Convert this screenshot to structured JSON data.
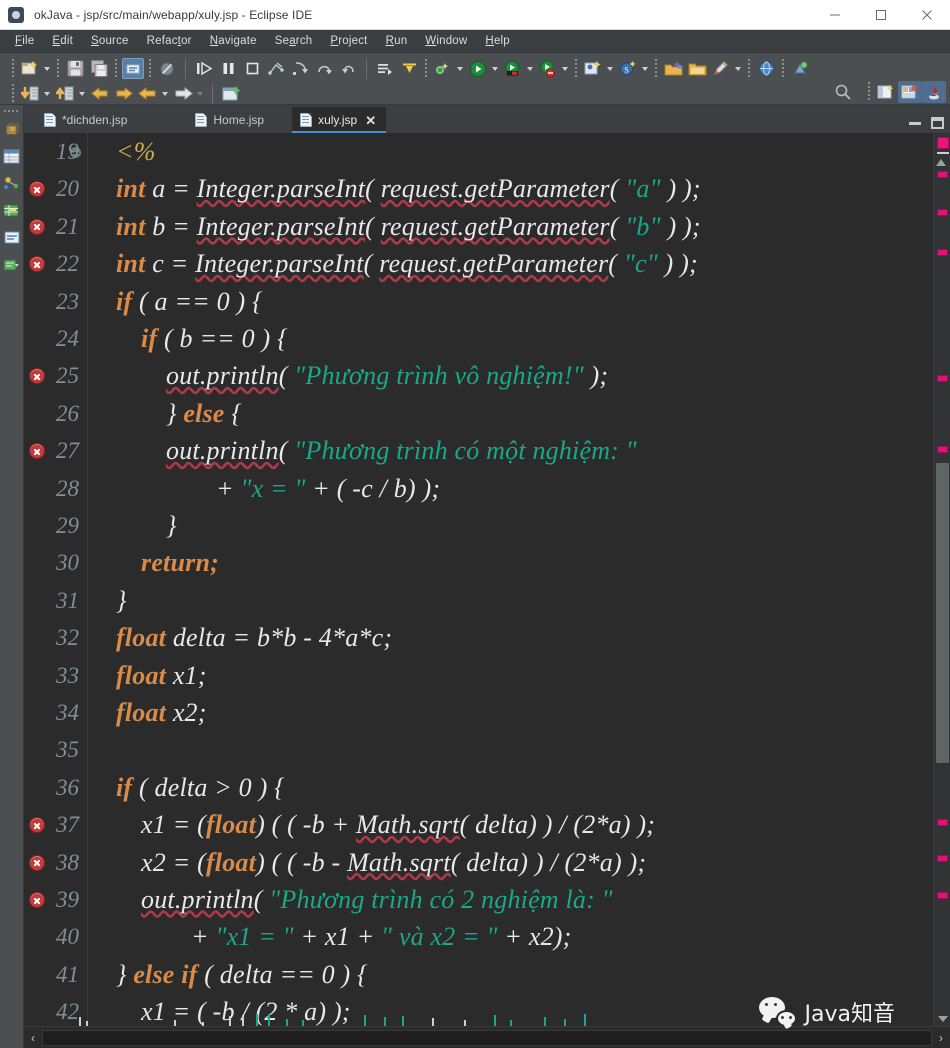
{
  "window": {
    "title": "okJava - jsp/src/main/webapp/xuly.jsp - Eclipse IDE",
    "app_icon": "eclipse-icon",
    "minimize_label": "—",
    "maximize_label": "☐",
    "close_label": "✕"
  },
  "menubar": {
    "items": [
      {
        "label": "File",
        "mnemonic": "F"
      },
      {
        "label": "Edit",
        "mnemonic": "E"
      },
      {
        "label": "Source",
        "mnemonic": "S"
      },
      {
        "label": "Refactor",
        "mnemonic": "t"
      },
      {
        "label": "Navigate",
        "mnemonic": "N"
      },
      {
        "label": "Search",
        "mnemonic": "a"
      },
      {
        "label": "Project",
        "mnemonic": "P"
      },
      {
        "label": "Run",
        "mnemonic": "R"
      },
      {
        "label": "Window",
        "mnemonic": "W"
      },
      {
        "label": "Help",
        "mnemonic": "H"
      }
    ]
  },
  "toolbar": {
    "row1_icons": [
      "new-wizard-icon",
      "save-icon",
      "save-all-icon",
      "toggle-comment-icon",
      "skip-all-breakpoints-icon",
      "resume-icon",
      "suspend-icon",
      "terminate-icon",
      "disconnect-icon",
      "step-into-icon",
      "step-over-icon",
      "step-return-icon",
      "next-annotation-icon",
      "previous-annotation-icon"
    ],
    "row2_icons": [
      "import-icon",
      "export-icon",
      "back-history-icon",
      "forward-history-icon",
      "previous-edit-icon",
      "next-edit-icon",
      "new-java-project-icon"
    ],
    "right_icons": [
      "run-last-tool-icon",
      "run-icon",
      "debug-icon",
      "coverage-icon",
      "new-class-icon",
      "new-package-icon",
      "open-type-icon",
      "open-task-icon",
      "external-tools-icon",
      "open-web-browser-icon",
      "search-icon"
    ],
    "perspective_icons": [
      "open-perspective-icon",
      "java-ee-perspective-icon",
      "java-perspective-icon"
    ],
    "quick_access_icon": "search-icon"
  },
  "leftbar": {
    "icons": [
      "restore-icon",
      "project-explorer-icon",
      "servers-icon",
      "markers-icon",
      "outline-icon",
      "console-icon"
    ]
  },
  "editor": {
    "tabs": [
      {
        "label": "*dichden.jsp",
        "icon": "jsp-file-icon",
        "active": false,
        "dirty": true
      },
      {
        "label": "Home.jsp",
        "icon": "jsp-file-icon",
        "active": false,
        "dirty": false
      },
      {
        "label": "xuly.jsp",
        "icon": "jsp-file-icon",
        "active": true,
        "dirty": false,
        "close": "✕"
      }
    ],
    "minimize_label": "minimize-editor",
    "maximize_label": "maximize-editor",
    "first_visible_line": 19,
    "lines": [
      {
        "n": 19,
        "error": false,
        "fold": true,
        "indent": 0,
        "tokens": [
          {
            "t": "<%",
            "c": "jsp"
          }
        ]
      },
      {
        "n": 20,
        "error": true,
        "fold": false,
        "indent": 0,
        "tokens": [
          {
            "t": "int ",
            "c": "kw"
          },
          {
            "t": "a = ",
            "c": "plain"
          },
          {
            "t": "Integer.parseInt",
            "c": "sq"
          },
          {
            "t": "( ",
            "c": "plain"
          },
          {
            "t": "request.getParameter",
            "c": "sq"
          },
          {
            "t": "( ",
            "c": "plain"
          },
          {
            "t": "\"a\"",
            "c": "str"
          },
          {
            "t": " ) );",
            "c": "plain"
          }
        ]
      },
      {
        "n": 21,
        "error": true,
        "fold": false,
        "indent": 0,
        "tokens": [
          {
            "t": "int ",
            "c": "kw"
          },
          {
            "t": "b = ",
            "c": "plain"
          },
          {
            "t": "Integer.parseInt",
            "c": "sq"
          },
          {
            "t": "( ",
            "c": "plain"
          },
          {
            "t": "request.getParameter",
            "c": "sq"
          },
          {
            "t": "( ",
            "c": "plain"
          },
          {
            "t": "\"b\"",
            "c": "str"
          },
          {
            "t": " ) );",
            "c": "plain"
          }
        ]
      },
      {
        "n": 22,
        "error": true,
        "fold": false,
        "indent": 0,
        "tokens": [
          {
            "t": "int ",
            "c": "kw"
          },
          {
            "t": "c = ",
            "c": "plain"
          },
          {
            "t": "Integer.parseInt",
            "c": "sq"
          },
          {
            "t": "( ",
            "c": "plain"
          },
          {
            "t": "request.getParameter",
            "c": "sq"
          },
          {
            "t": "( ",
            "c": "plain"
          },
          {
            "t": "\"c\"",
            "c": "str"
          },
          {
            "t": " ) );",
            "c": "plain"
          }
        ]
      },
      {
        "n": 23,
        "error": false,
        "fold": false,
        "indent": 0,
        "tokens": [
          {
            "t": "if ",
            "c": "kw"
          },
          {
            "t": "( a == 0 ) {",
            "c": "plain"
          }
        ]
      },
      {
        "n": 24,
        "error": false,
        "fold": false,
        "indent": 1,
        "tokens": [
          {
            "t": "if ",
            "c": "kw"
          },
          {
            "t": "( b == 0 ) {",
            "c": "plain"
          }
        ]
      },
      {
        "n": 25,
        "error": true,
        "fold": false,
        "indent": 2,
        "tokens": [
          {
            "t": "out.println",
            "c": "sq"
          },
          {
            "t": "( ",
            "c": "plain"
          },
          {
            "t": "\"Phương trình vô nghiệm!\"",
            "c": "str"
          },
          {
            "t": " );",
            "c": "plain"
          }
        ]
      },
      {
        "n": 26,
        "error": false,
        "fold": false,
        "indent": 2,
        "tokens": [
          {
            "t": "} ",
            "c": "plain"
          },
          {
            "t": "else",
            "c": "kw"
          },
          {
            "t": " {",
            "c": "plain"
          }
        ]
      },
      {
        "n": 27,
        "error": true,
        "fold": false,
        "indent": 2,
        "tokens": [
          {
            "t": "out.println",
            "c": "sq"
          },
          {
            "t": "( ",
            "c": "plain"
          },
          {
            "t": "\"Phương trình có một nghiệm: \"",
            "c": "str"
          }
        ]
      },
      {
        "n": 28,
        "error": false,
        "fold": false,
        "indent": 4,
        "tokens": [
          {
            "t": "+ ",
            "c": "plain"
          },
          {
            "t": "\"x = \"",
            "c": "str"
          },
          {
            "t": " + ( -c / b) );",
            "c": "plain"
          }
        ]
      },
      {
        "n": 29,
        "error": false,
        "fold": false,
        "indent": 2,
        "tokens": [
          {
            "t": "}",
            "c": "plain"
          }
        ]
      },
      {
        "n": 30,
        "error": false,
        "fold": false,
        "indent": 1,
        "tokens": [
          {
            "t": "return;",
            "c": "kw"
          }
        ]
      },
      {
        "n": 31,
        "error": false,
        "fold": false,
        "indent": 0,
        "tokens": [
          {
            "t": "}",
            "c": "plain"
          }
        ]
      },
      {
        "n": 32,
        "error": false,
        "fold": false,
        "indent": 0,
        "tokens": [
          {
            "t": "float ",
            "c": "kw"
          },
          {
            "t": "delta = b*b - 4*a*c;",
            "c": "plain"
          }
        ]
      },
      {
        "n": 33,
        "error": false,
        "fold": false,
        "indent": 0,
        "tokens": [
          {
            "t": "float ",
            "c": "kw"
          },
          {
            "t": "x1;",
            "c": "plain"
          }
        ]
      },
      {
        "n": 34,
        "error": false,
        "fold": false,
        "indent": 0,
        "tokens": [
          {
            "t": "float ",
            "c": "kw"
          },
          {
            "t": "x2;",
            "c": "plain"
          }
        ]
      },
      {
        "n": 35,
        "error": false,
        "fold": false,
        "indent": 0,
        "tokens": []
      },
      {
        "n": 36,
        "error": false,
        "fold": false,
        "indent": 0,
        "tokens": [
          {
            "t": "if ",
            "c": "kw"
          },
          {
            "t": "( delta > 0 ) {",
            "c": "plain"
          }
        ]
      },
      {
        "n": 37,
        "error": true,
        "fold": false,
        "indent": 1,
        "tokens": [
          {
            "t": "x1 = (",
            "c": "plain"
          },
          {
            "t": "float",
            "c": "kw"
          },
          {
            "t": ") ( ( -b + ",
            "c": "plain"
          },
          {
            "t": "Math.sqrt",
            "c": "sq"
          },
          {
            "t": "( delta) ) / (2*a) );",
            "c": "plain"
          }
        ]
      },
      {
        "n": 38,
        "error": true,
        "fold": false,
        "indent": 1,
        "tokens": [
          {
            "t": "x2 = (",
            "c": "plain"
          },
          {
            "t": "float",
            "c": "kw"
          },
          {
            "t": ") ( ( -b - ",
            "c": "plain"
          },
          {
            "t": "Math.sqrt",
            "c": "sq"
          },
          {
            "t": "( delta) ) / (2*a) );",
            "c": "plain"
          }
        ]
      },
      {
        "n": 39,
        "error": true,
        "fold": false,
        "indent": 1,
        "tokens": [
          {
            "t": "out.println",
            "c": "sq"
          },
          {
            "t": "( ",
            "c": "plain"
          },
          {
            "t": "\"Phương trình có 2 nghiệm là: \"",
            "c": "str"
          }
        ]
      },
      {
        "n": 40,
        "error": false,
        "fold": false,
        "indent": 3,
        "tokens": [
          {
            "t": "+ ",
            "c": "plain"
          },
          {
            "t": "\"x1 = \"",
            "c": "str"
          },
          {
            "t": " + x1 + ",
            "c": "plain"
          },
          {
            "t": "\" và x2 = \"",
            "c": "str"
          },
          {
            "t": " + x2);",
            "c": "plain"
          }
        ]
      },
      {
        "n": 41,
        "error": false,
        "fold": false,
        "indent": 0,
        "tokens": [
          {
            "t": "} ",
            "c": "plain"
          },
          {
            "t": "else if ",
            "c": "kw"
          },
          {
            "t": "( delta == 0 ) {",
            "c": "plain"
          }
        ]
      },
      {
        "n": 42,
        "error": false,
        "fold": false,
        "indent": 1,
        "tokens": [
          {
            "t": "x1 = ( -b / (2 * a) );",
            "c": "plain"
          }
        ]
      }
    ],
    "overview_markers_y": [
      168,
      206,
      246,
      372,
      443,
      816,
      852,
      889
    ],
    "scroll": {
      "left_arrow": "‹",
      "right_arrow": "›",
      "down_arrow": "⌵"
    }
  },
  "watermark": {
    "text": "Java知音",
    "icon": "wechat-icon"
  },
  "colors": {
    "keyword": "#d98b4a",
    "string": "#1aa88a",
    "jsp_tag": "#cfae4a",
    "plain_text": "#e8e8e8",
    "editor_bg": "#2b2b2b",
    "chrome_bg": "#3c3f41",
    "toolbar_bg": "#4b4f51",
    "error_marker": "#c63a3a",
    "overview_marker": "#e0117f",
    "tab_accent": "#4a90d9"
  }
}
